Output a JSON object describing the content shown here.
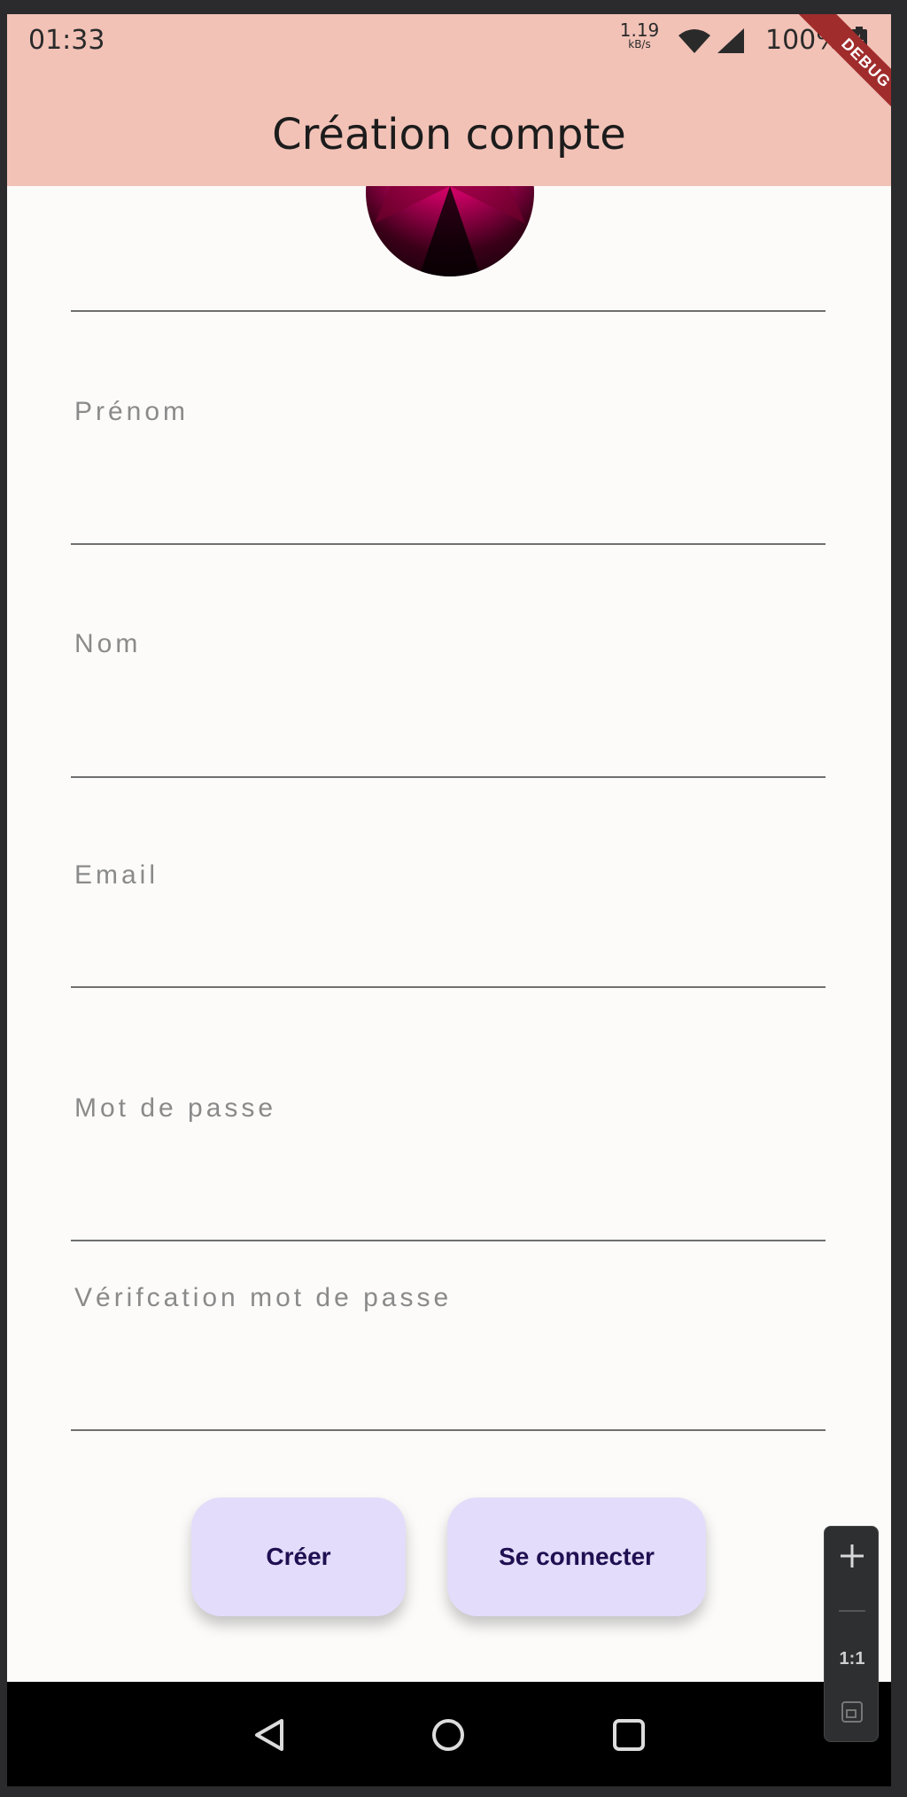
{
  "status_bar": {
    "time": "01:33",
    "speed_value": "1.19",
    "speed_unit": "kB/s",
    "battery": "100%"
  },
  "debug_banner": "DEBUG",
  "app_bar": {
    "title": "Création compte"
  },
  "form": {
    "fields": [
      {
        "label": "Prénom"
      },
      {
        "label": "Nom"
      },
      {
        "label": "Email"
      },
      {
        "label": "Mot de passe"
      },
      {
        "label": "Vérifcation mot de passe"
      }
    ]
  },
  "buttons": {
    "create": "Créer",
    "login": "Se connecter"
  },
  "emulator_zoom": {
    "ratio": "1:1"
  },
  "colors": {
    "app_bar": "#f2c2b7",
    "button_bg": "#e3dcfa",
    "button_text": "#1f0f52",
    "debug_ribbon": "#a02c2c"
  }
}
